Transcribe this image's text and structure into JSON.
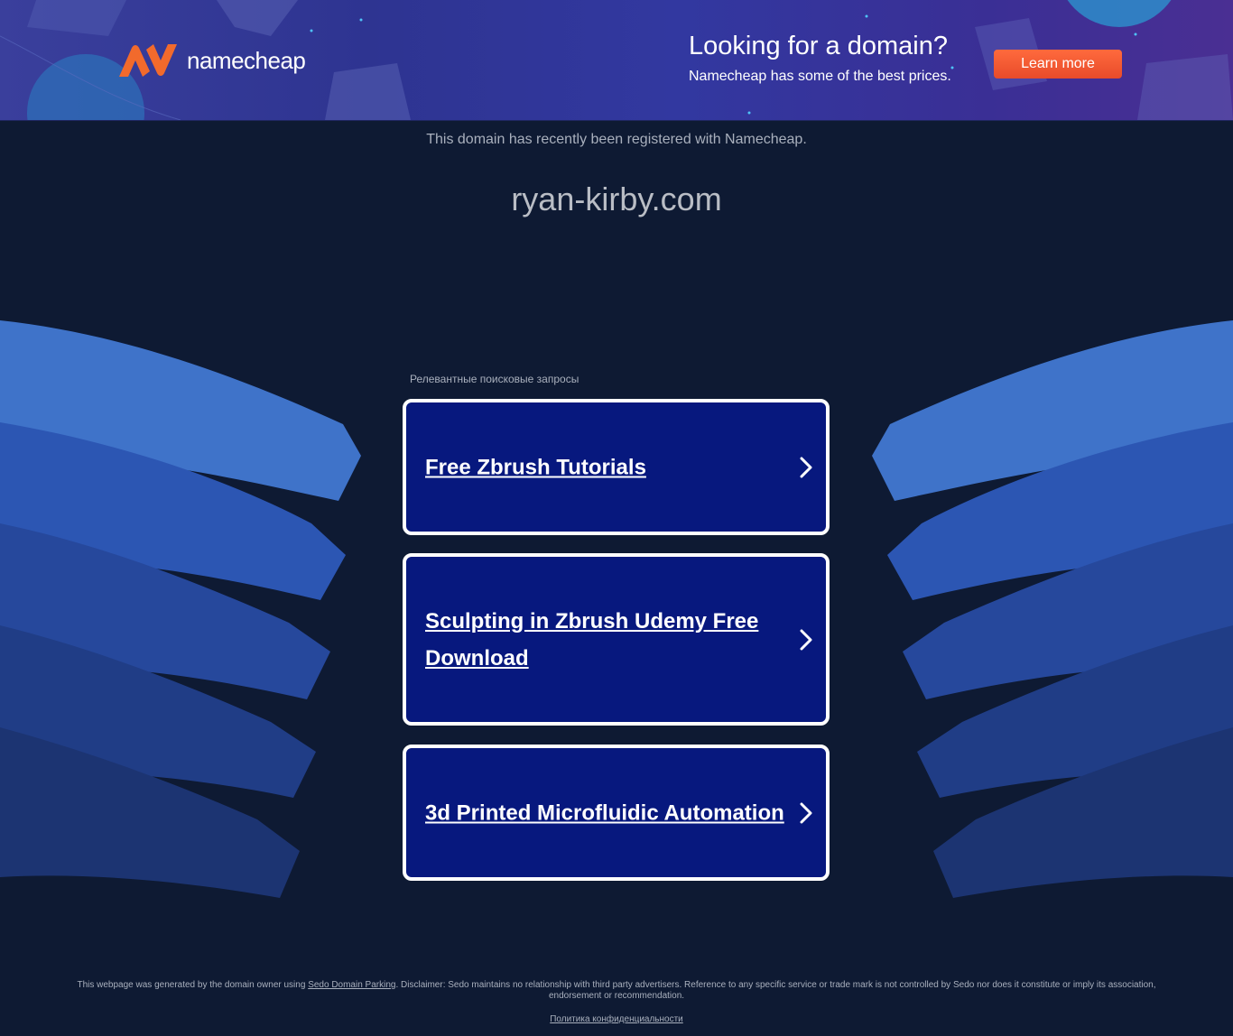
{
  "colors": {
    "page_background": "#0e1a33",
    "banner_background": "#3238a0",
    "accent_orange": "#ff6a3d",
    "ad_background": "#07187e",
    "muted_text": "#a9b0bd"
  },
  "banner": {
    "logo_icon": "namecheap-n-logo-icon",
    "logo_text": "namecheap",
    "headline": "Looking for a domain?",
    "subline": "Namecheap has some of the best prices.",
    "cta_label": "Learn more"
  },
  "main": {
    "registered_note": "This domain has recently been registered with Namecheap.",
    "domain": "ryan-kirby.com"
  },
  "related": {
    "title": "Релевантные поисковые запросы",
    "items": [
      {
        "label": "Free Zbrush Tutorials",
        "icon": "chevron-right-icon"
      },
      {
        "label": "Sculpting in Zbrush Udemy Free Download",
        "icon": "chevron-right-icon"
      },
      {
        "label": "3d Printed Microfluidic Automation",
        "icon": "chevron-right-icon"
      }
    ]
  },
  "footer": {
    "text_before_link": "This webpage was generated by the domain owner using ",
    "link_label": "Sedo Domain Parking",
    "text_after_link": ". Disclaimer: Sedo maintains no relationship with third party advertisers. Reference to any specific service or trade mark is not controlled by Sedo nor does it constitute or imply its association, endorsement or recommendation.",
    "privacy_label": "Политика конфиденциальности"
  }
}
